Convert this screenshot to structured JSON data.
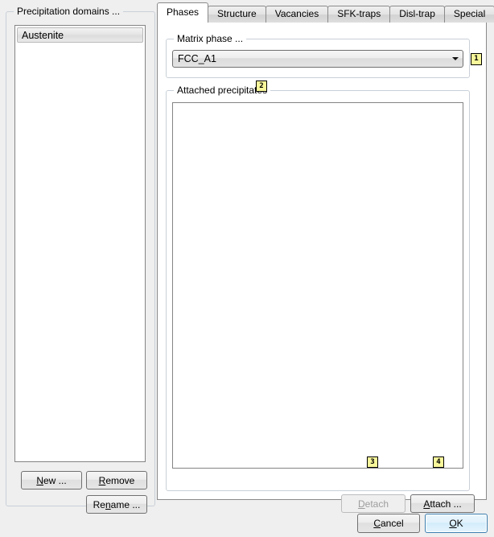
{
  "left_panel": {
    "title": "Precipitation domains ...",
    "list": {
      "items": [
        {
          "label": "Austenite",
          "selected": true
        }
      ]
    },
    "buttons": {
      "new": {
        "pre": "",
        "mnemonic": "N",
        "post": "ew ..."
      },
      "remove": {
        "pre": "",
        "mnemonic": "R",
        "post": "emove"
      },
      "rename": {
        "pre": "Re",
        "mnemonic": "n",
        "post": "ame ..."
      }
    }
  },
  "tabs": [
    {
      "label": "Phases",
      "active": true
    },
    {
      "label": "Structure",
      "active": false
    },
    {
      "label": "Vacancies",
      "active": false
    },
    {
      "label": "SFK-traps",
      "active": false
    },
    {
      "label": "Disl-trap",
      "active": false
    },
    {
      "label": "Special",
      "active": false
    }
  ],
  "phases_tab": {
    "matrix_phase": {
      "title": "Matrix phase ...",
      "selected_value": "FCC_A1",
      "options": [
        "FCC_A1"
      ],
      "arrow_icon": "chevron-down-icon"
    },
    "attached_precipitates": {
      "title": "Attached precipitates",
      "items": []
    },
    "buttons": {
      "detach": {
        "pre": "",
        "mnemonic": "D",
        "post": "etach",
        "disabled": true
      },
      "attach": {
        "pre": "",
        "mnemonic": "A",
        "post": "ttach ...",
        "disabled": false
      }
    }
  },
  "footer": {
    "cancel": {
      "pre": "",
      "mnemonic": "C",
      "post": "ancel"
    },
    "ok": {
      "pre": "",
      "mnemonic": "O",
      "post": "K"
    }
  },
  "badges": [
    {
      "id": 1,
      "label": "1",
      "target": "matrix-phase-combo"
    },
    {
      "id": 2,
      "label": "2",
      "target": "attached-precipitates-group"
    },
    {
      "id": 3,
      "label": "3",
      "target": "detach-button"
    },
    {
      "id": 4,
      "label": "4",
      "target": "attach-button"
    }
  ],
  "colors": {
    "window_background": "#efefef",
    "badge_fill": "#f8f79a",
    "default_button_border": "#3c7fb1",
    "panel_border": "#8a8a8a",
    "groupbox_border": "#c8d0d8"
  }
}
